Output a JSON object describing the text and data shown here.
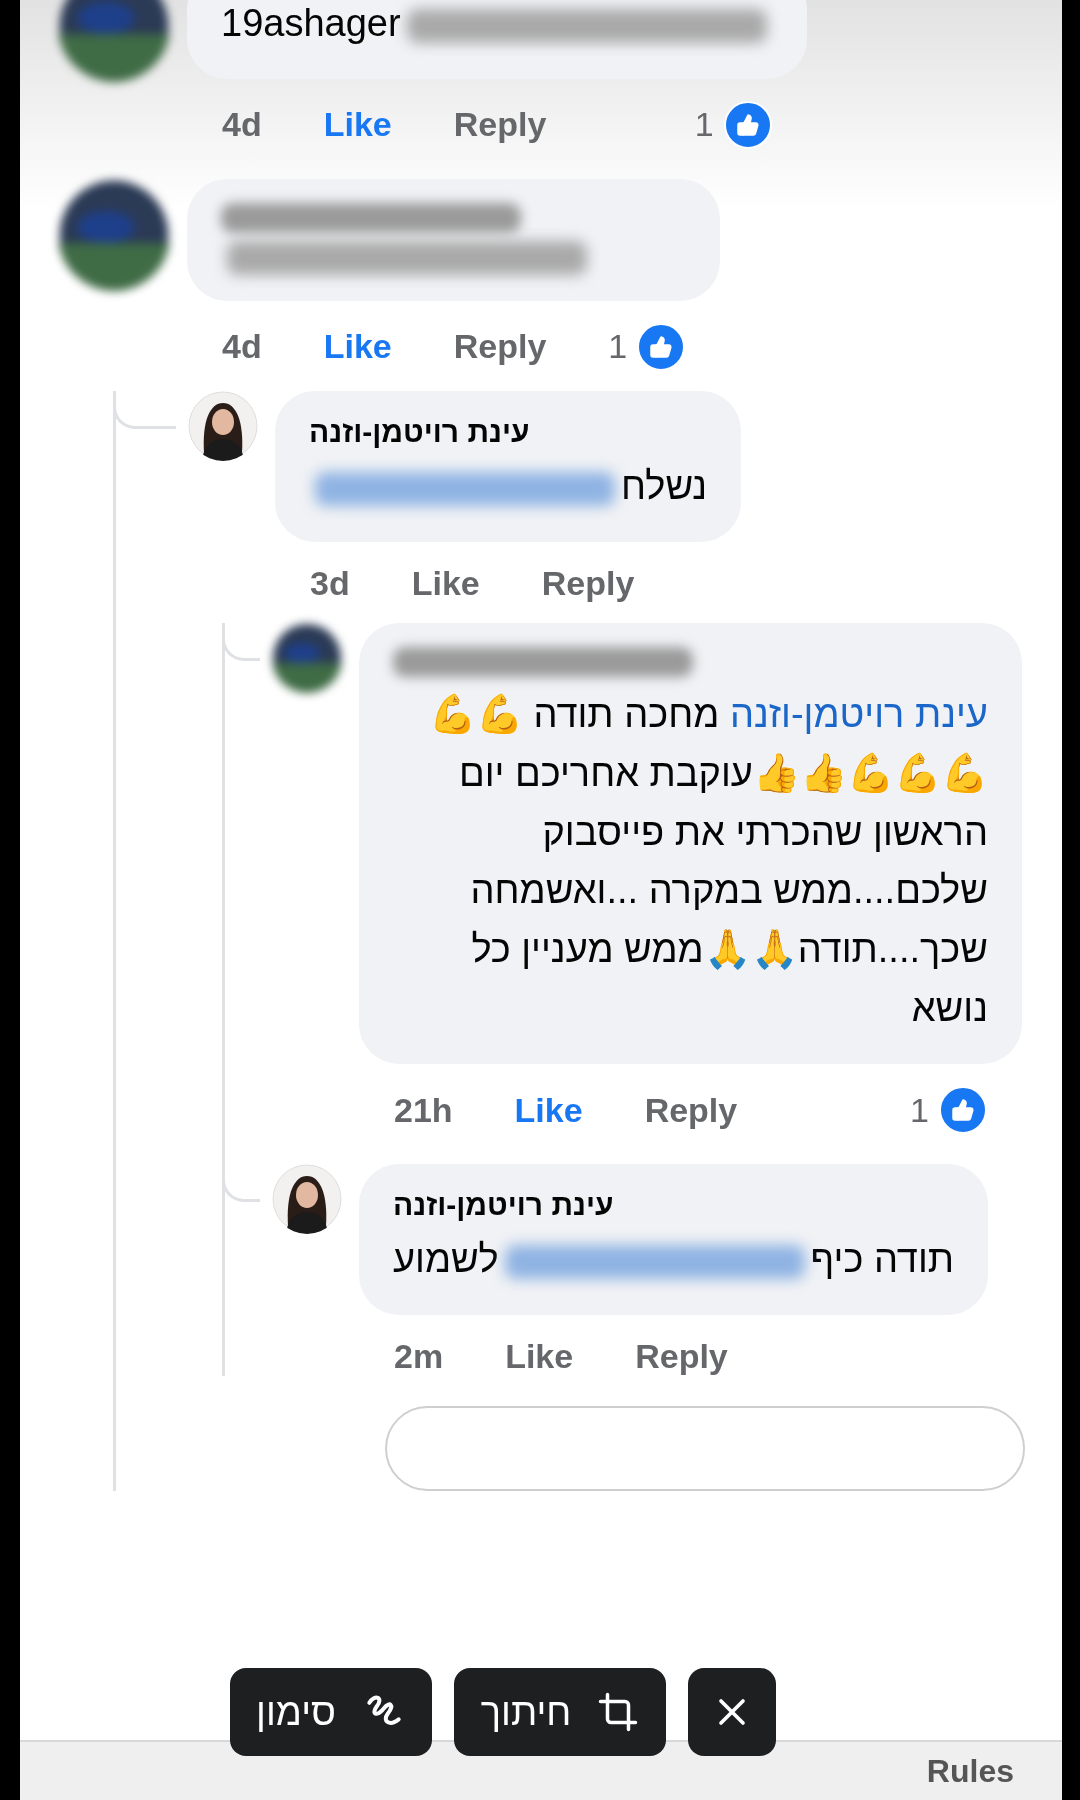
{
  "comments": [
    {
      "avatar_blurred": true,
      "body": [
        {
          "kind": "text",
          "text": "19ashager"
        },
        {
          "kind": "redacted"
        }
      ],
      "time": "4d",
      "like_label": "Like",
      "liked": true,
      "reply_label": "Reply",
      "reactions": "1"
    },
    {
      "avatar_blurred": true,
      "author_redacted": true,
      "body": [
        {
          "kind": "redacted"
        }
      ],
      "time": "4d",
      "like_label": "Like",
      "liked": true,
      "reply_label": "Reply",
      "reactions": "1",
      "children": [
        {
          "avatar_blurred": false,
          "author": "עינת רויטמן-וזנה",
          "body": [
            {
              "kind": "text",
              "text": "נשלח"
            },
            {
              "kind": "redacted_link"
            }
          ],
          "time": "3d",
          "like_label": "Like",
          "liked": false,
          "reply_label": "Reply",
          "children": [
            {
              "avatar_blurred": true,
              "author_redacted": true,
              "body": [
                {
                  "kind": "mention",
                  "text": "עינת רויטמן-וזנה"
                },
                {
                  "kind": "text",
                  "text": " מחכה תודה 💪💪💪💪💪👍👍עוקבת אחריכם יום הראשון שהכרתי את פייסבוק שלכם....ממש במקרה ...ואשמחה שכך....תודה🙏🙏ממש מעניין כל נושא"
                }
              ],
              "time": "21h",
              "like_label": "Like",
              "liked": true,
              "reply_label": "Reply",
              "reactions": "1"
            },
            {
              "avatar_blurred": false,
              "author": "עינת רויטמן-וזנה",
              "body": [
                {
                  "kind": "text",
                  "text": "תודה כיף"
                },
                {
                  "kind": "redacted_link"
                },
                {
                  "kind": "text",
                  "text": "לשמוע"
                }
              ],
              "time": "2m",
              "like_label": "Like",
              "liked": false,
              "reply_label": "Reply"
            }
          ]
        }
      ]
    }
  ],
  "overlay_toolbar": [
    {
      "kind": "close"
    },
    {
      "kind": "crop",
      "label": "חיתוך"
    },
    {
      "kind": "markup",
      "label": "סימון"
    }
  ],
  "footer": {
    "link": "Rules"
  }
}
